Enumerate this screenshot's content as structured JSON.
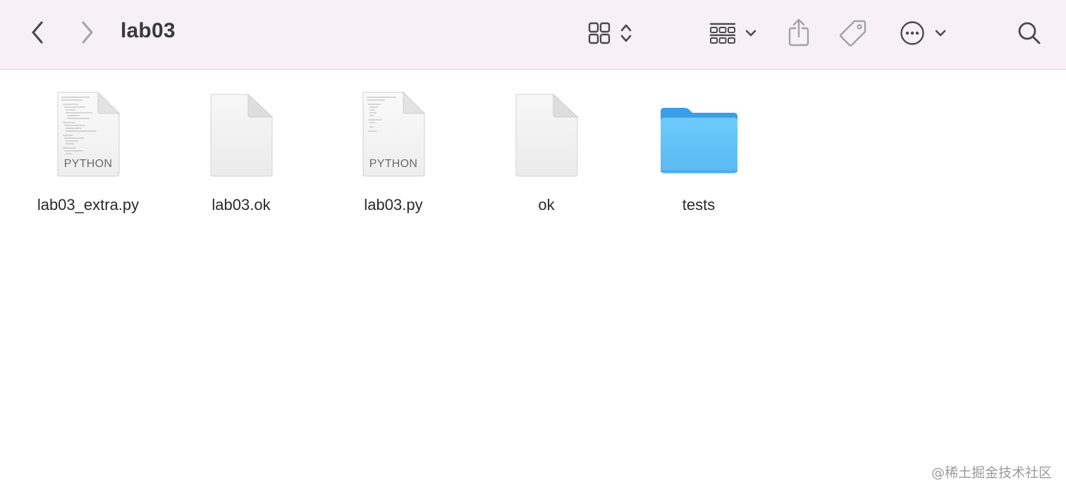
{
  "window": {
    "title": "lab03"
  },
  "toolbar": {
    "back_icon": "chevron-left-icon",
    "forward_icon": "chevron-right-icon",
    "view_icon": "icon-grid-view-icon",
    "group_icon": "group-by-icon",
    "share_icon": "share-icon",
    "tag_icon": "tag-icon",
    "more_icon": "ellipsis-circle-icon",
    "search_icon": "search-icon"
  },
  "files": [
    {
      "name": "lab03_extra.py",
      "kind": "python",
      "badge": "PYTHON"
    },
    {
      "name": "lab03.ok",
      "kind": "blank"
    },
    {
      "name": "lab03.py",
      "kind": "python",
      "badge": "PYTHON"
    },
    {
      "name": "ok",
      "kind": "blank"
    },
    {
      "name": "tests",
      "kind": "folder"
    }
  ],
  "watermark": "@稀土掘金技术社区",
  "colors": {
    "toolbar_bg": "#f7f1f5",
    "folder_blue": "#5cc1f7",
    "folder_tab": "#2f9be6"
  }
}
